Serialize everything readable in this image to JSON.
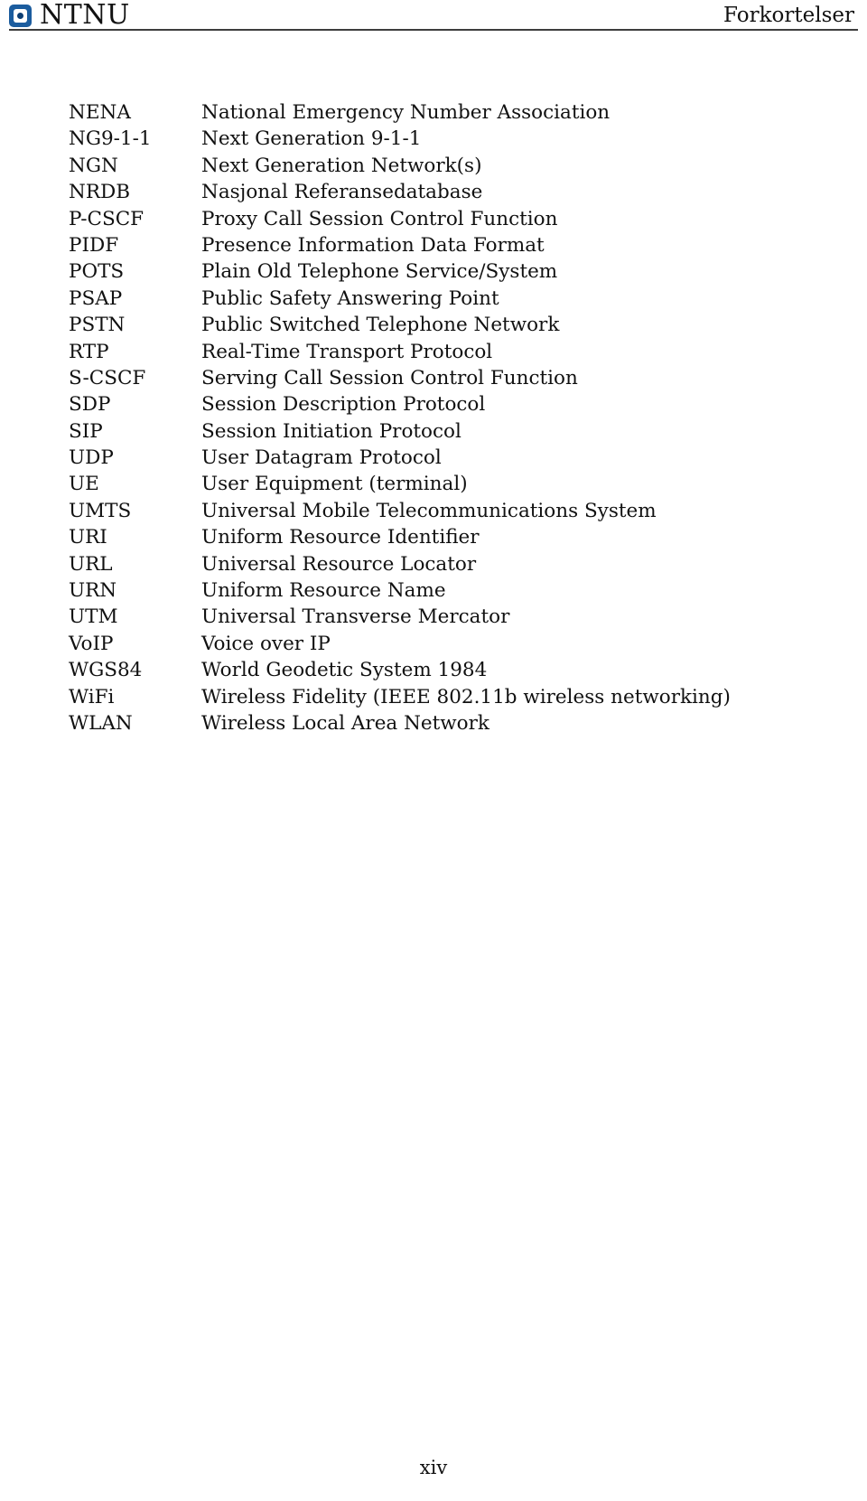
{
  "header": {
    "logo_text": "NTNU",
    "logo_icon": "ntnu-square-logo",
    "running_title": "Forkortelser",
    "rule_color": "#3d3d3d"
  },
  "abbreviations": [
    {
      "term": "NENA",
      "definition": "National Emergency Number Association"
    },
    {
      "term": "NG9-1-1",
      "definition": "Next Generation 9-1-1"
    },
    {
      "term": "NGN",
      "definition": "Next Generation Network(s)"
    },
    {
      "term": "NRDB",
      "definition": "Nasjonal Referansedatabase"
    },
    {
      "term": "P-CSCF",
      "definition": "Proxy Call Session Control Function"
    },
    {
      "term": "PIDF",
      "definition": "Presence Information Data Format"
    },
    {
      "term": "POTS",
      "definition": "Plain Old Telephone Service/System"
    },
    {
      "term": "PSAP",
      "definition": "Public Safety Answering Point"
    },
    {
      "term": "PSTN",
      "definition": "Public Switched Telephone Network"
    },
    {
      "term": "RTP",
      "definition": "Real-Time Transport Protocol"
    },
    {
      "term": "S-CSCF",
      "definition": "Serving Call Session Control Function"
    },
    {
      "term": "SDP",
      "definition": "Session Description Protocol"
    },
    {
      "term": "SIP",
      "definition": "Session Initiation Protocol"
    },
    {
      "term": "UDP",
      "definition": "User Datagram Protocol"
    },
    {
      "term": "UE",
      "definition": "User Equipment (terminal)"
    },
    {
      "term": "UMTS",
      "definition": "Universal Mobile Telecommunications System"
    },
    {
      "term": "URI",
      "definition": "Uniform Resource Identifier"
    },
    {
      "term": "URL",
      "definition": "Universal Resource Locator"
    },
    {
      "term": "URN",
      "definition": "Uniform Resource Name"
    },
    {
      "term": "UTM",
      "definition": "Universal Transverse Mercator"
    },
    {
      "term": "VoIP",
      "definition": "Voice over IP"
    },
    {
      "term": "WGS84",
      "definition": "World Geodetic System 1984"
    },
    {
      "term": "WiFi",
      "definition": "Wireless Fidelity (IEEE 802.11b wireless networking)"
    },
    {
      "term": "WLAN",
      "definition": "Wireless Local Area Network"
    }
  ],
  "footer": {
    "page_number": "xiv"
  }
}
